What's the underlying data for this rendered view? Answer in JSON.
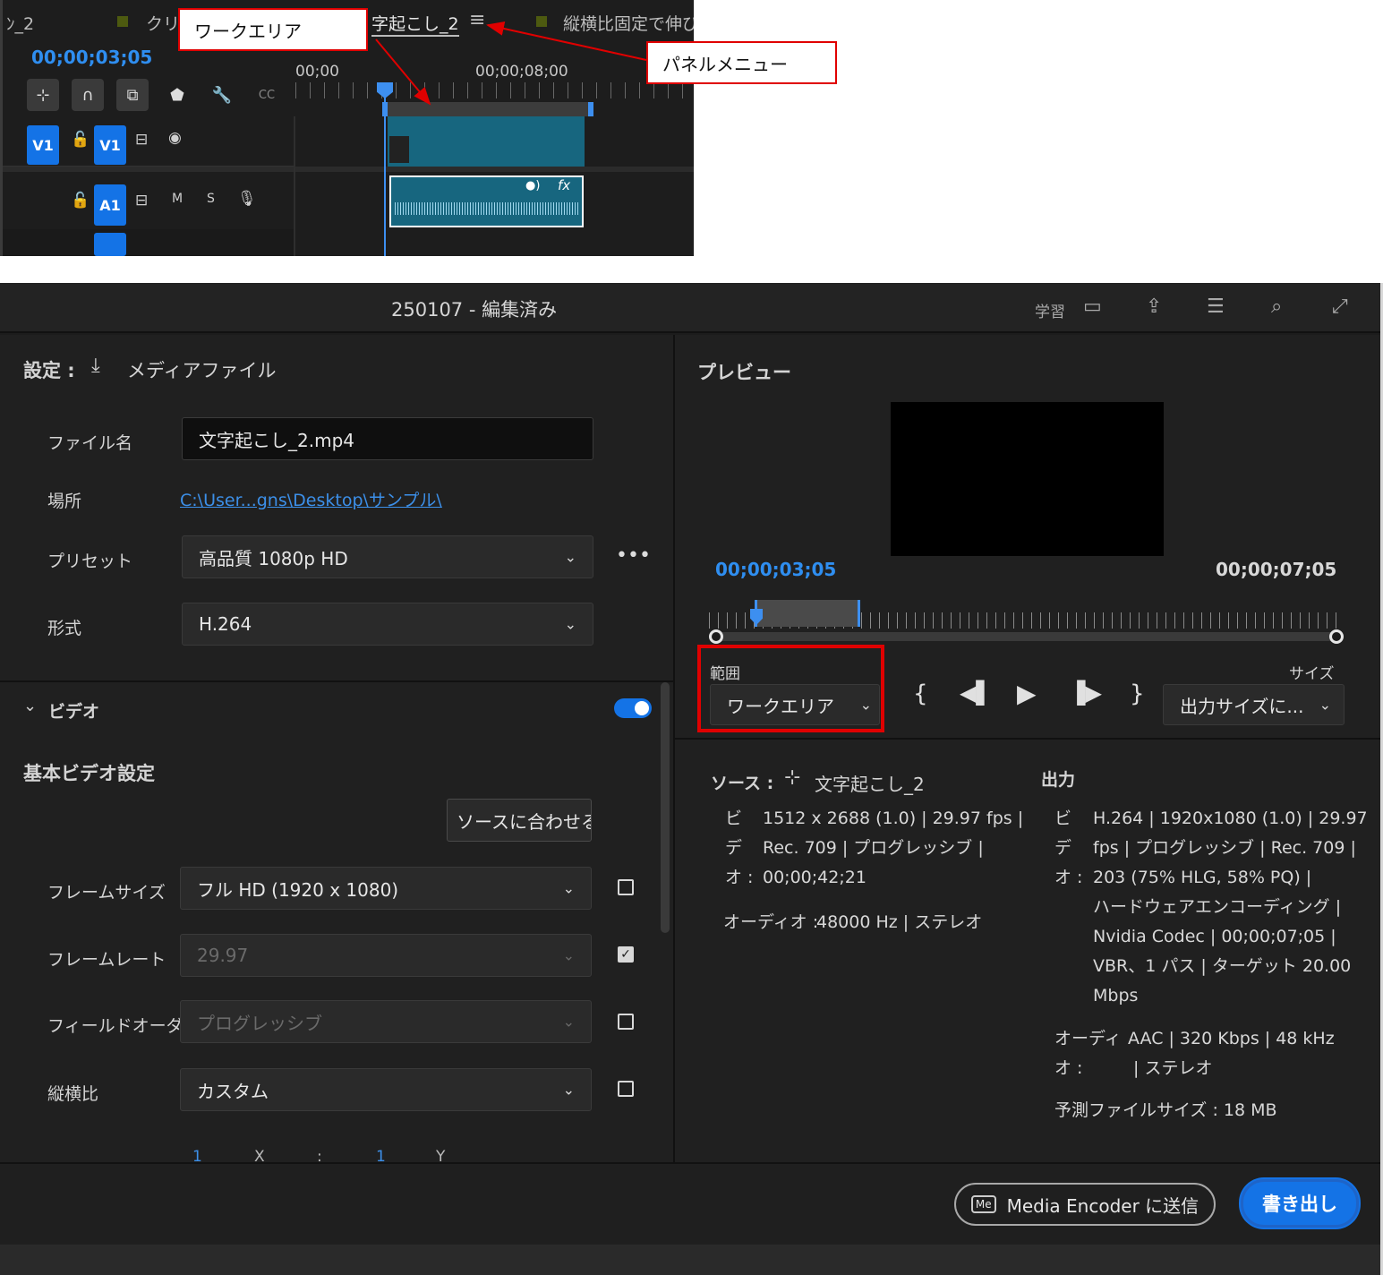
{
  "timeline": {
    "tabs": [
      "ﾝ_2",
      "クリ",
      "字起こし_2",
      "縦横比固定で伸び"
    ],
    "timecode": "00;00;03;05",
    "ruler": [
      "00;00",
      "00;00;08;00"
    ],
    "track_v1": "V1",
    "track_v1_target": "V1",
    "track_a1": "A1",
    "track_mute": "M",
    "track_solo": "S",
    "clip_fx": "fx"
  },
  "annotations": {
    "work_area": "ワークエリア",
    "panel_menu": "パネルメニュー"
  },
  "dialog": {
    "title": "250107 - 編集済み",
    "header_learn": "学習",
    "settings": {
      "label": "設定 :",
      "destination": "メディアファイル",
      "filename_label": "ファイル名",
      "filename_value": "文字起こし_2.mp4",
      "location_label": "場所",
      "location_value": "C:\\User...gns\\Desktop\\サンプル\\",
      "preset_label": "プリセット",
      "preset_value": "高品質 1080p HD",
      "format_label": "形式",
      "format_value": "H.264",
      "video_section": "ビデオ",
      "basic_video": "基本ビデオ設定",
      "match_source": "ソースに合わせる",
      "frame_size_label": "フレームサイズ",
      "frame_size_value": "フル HD (1920 x 1080)",
      "frame_rate_label": "フレームレート",
      "frame_rate_value": "29.97",
      "field_order_label": "フィールドオーダー",
      "field_order_value": "プログレッシブ",
      "aspect_label": "縦横比",
      "aspect_value": "カスタム",
      "aspect_row": [
        "1",
        "X",
        ":",
        "1",
        "Y"
      ]
    },
    "preview": {
      "label": "プレビュー",
      "time_in": "00;00;03;05",
      "time_out": "00;00;07;05",
      "range_label": "範囲",
      "range_value": "ワークエリア",
      "size_label": "サイズ",
      "size_value": "出力サイズに..."
    },
    "source": {
      "label": "ソース :",
      "name": "文字起こし_2",
      "video_label": [
        "ビ",
        "デ",
        "オ :"
      ],
      "video_lines": [
        "1512 x 2688 (1.0) | 29.97 fps |",
        "Rec. 709 | プログレッシブ |",
        "00;00;42;21"
      ],
      "audio_label": "オーディオ :",
      "audio_value": "48000 Hz | ステレオ"
    },
    "output": {
      "label": "出力",
      "video_label": [
        "ビ",
        "デ",
        "オ :"
      ],
      "video_lines": [
        "H.264 | 1920x1080 (1.0) | 29.97",
        "fps | プログレッシブ | Rec. 709 |",
        "203 (75% HLG, 58% PQ) |",
        "ハードウェアエンコーディング |",
        "Nvidia Codec | 00;00;07;05 |",
        "VBR、1 パス | ターゲット 20.00",
        "Mbps"
      ],
      "audio_label": [
        "オーディ",
        "オ :"
      ],
      "audio_lines": [
        "AAC | 320 Kbps | 48 kHz",
        "| ステレオ"
      ],
      "estimated_size": "予測ファイルサイズ :  18 MB"
    },
    "footer": {
      "media_encoder_badge": "Me",
      "media_encoder": "Media Encoder に送信",
      "export": "書き出し"
    },
    "colors": {
      "accent": "#1473e6",
      "timecode": "#2f8ef0",
      "annotation": "#e00000"
    }
  }
}
